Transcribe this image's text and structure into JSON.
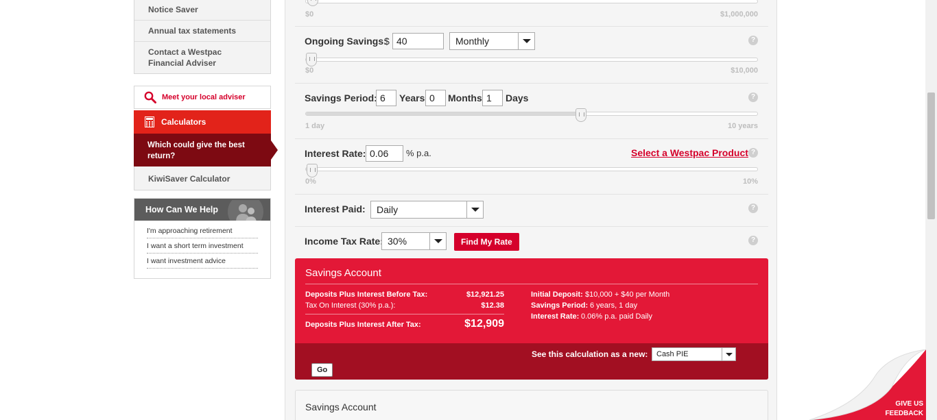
{
  "sidebar": {
    "nav_items": [
      "Notice Saver",
      "Annual tax statements",
      "Contact a Westpac Financial Adviser"
    ],
    "adviser_label": "Meet your local adviser",
    "calculators_label": "Calculators",
    "active_item": "Which could give the best return?",
    "kiwi_item": "KiwiSaver Calculator",
    "help_title": "How Can We Help",
    "help_links": [
      "I'm approaching retirement",
      "I want a short term investment",
      "I want investment advice"
    ]
  },
  "calculator": {
    "deposit_min": "$0",
    "deposit_max": "$1,000,000",
    "ongoing": {
      "label": "Ongoing Savings:",
      "currency": "$",
      "value": "40",
      "frequency": "Monthly",
      "min": "$0",
      "max": "$10,000",
      "level": 0.004
    },
    "period": {
      "label": "Savings Period:",
      "years": "6",
      "years_label": "Years",
      "months": "0",
      "months_label": "Months",
      "days": "1",
      "days_label": "Days",
      "min": "1 day",
      "max": "10 years",
      "level": 0.6
    },
    "interest": {
      "label": "Interest Rate:",
      "value": "0.06",
      "unit": "% p.a.",
      "product_link": "Select a Westpac Product",
      "min": "0%",
      "max": "10%",
      "level": 0.006
    },
    "paid": {
      "label": "Interest Paid:",
      "value": "Daily"
    },
    "tax": {
      "label": "Income Tax Rate:",
      "value": "30%",
      "button": "Find My Rate"
    },
    "help_glyph": "?"
  },
  "result": {
    "title": "Savings Account",
    "before_tax_label": "Deposits Plus Interest Before Tax:",
    "before_tax_value": "$12,921.25",
    "tax_label": "Tax On Interest (30% p.a.):",
    "tax_value": "$12.38",
    "after_tax_label": "Deposits Plus Interest After Tax:",
    "after_tax_value": "$12,909",
    "initial_deposit_label": "Initial Deposit:",
    "initial_deposit_value": "$10,000 + $40 per Month",
    "period_label": "Savings Period:",
    "period_value": "6 years, 1 day",
    "rate_label": "Interest Rate:",
    "rate_value": "0.06% p.a. paid Daily",
    "see_label": "See this calculation as a new:",
    "new_type": "Cash PIE",
    "go_label": "Go"
  },
  "result2": {
    "title": "Savings Account"
  },
  "feedback": {
    "line1": "GIVE US",
    "line2": "FEEDBACK"
  },
  "colors": {
    "brand_red": "#e31837",
    "dark_red": "#a20f22",
    "sidebar_active": "#7d0a12"
  }
}
